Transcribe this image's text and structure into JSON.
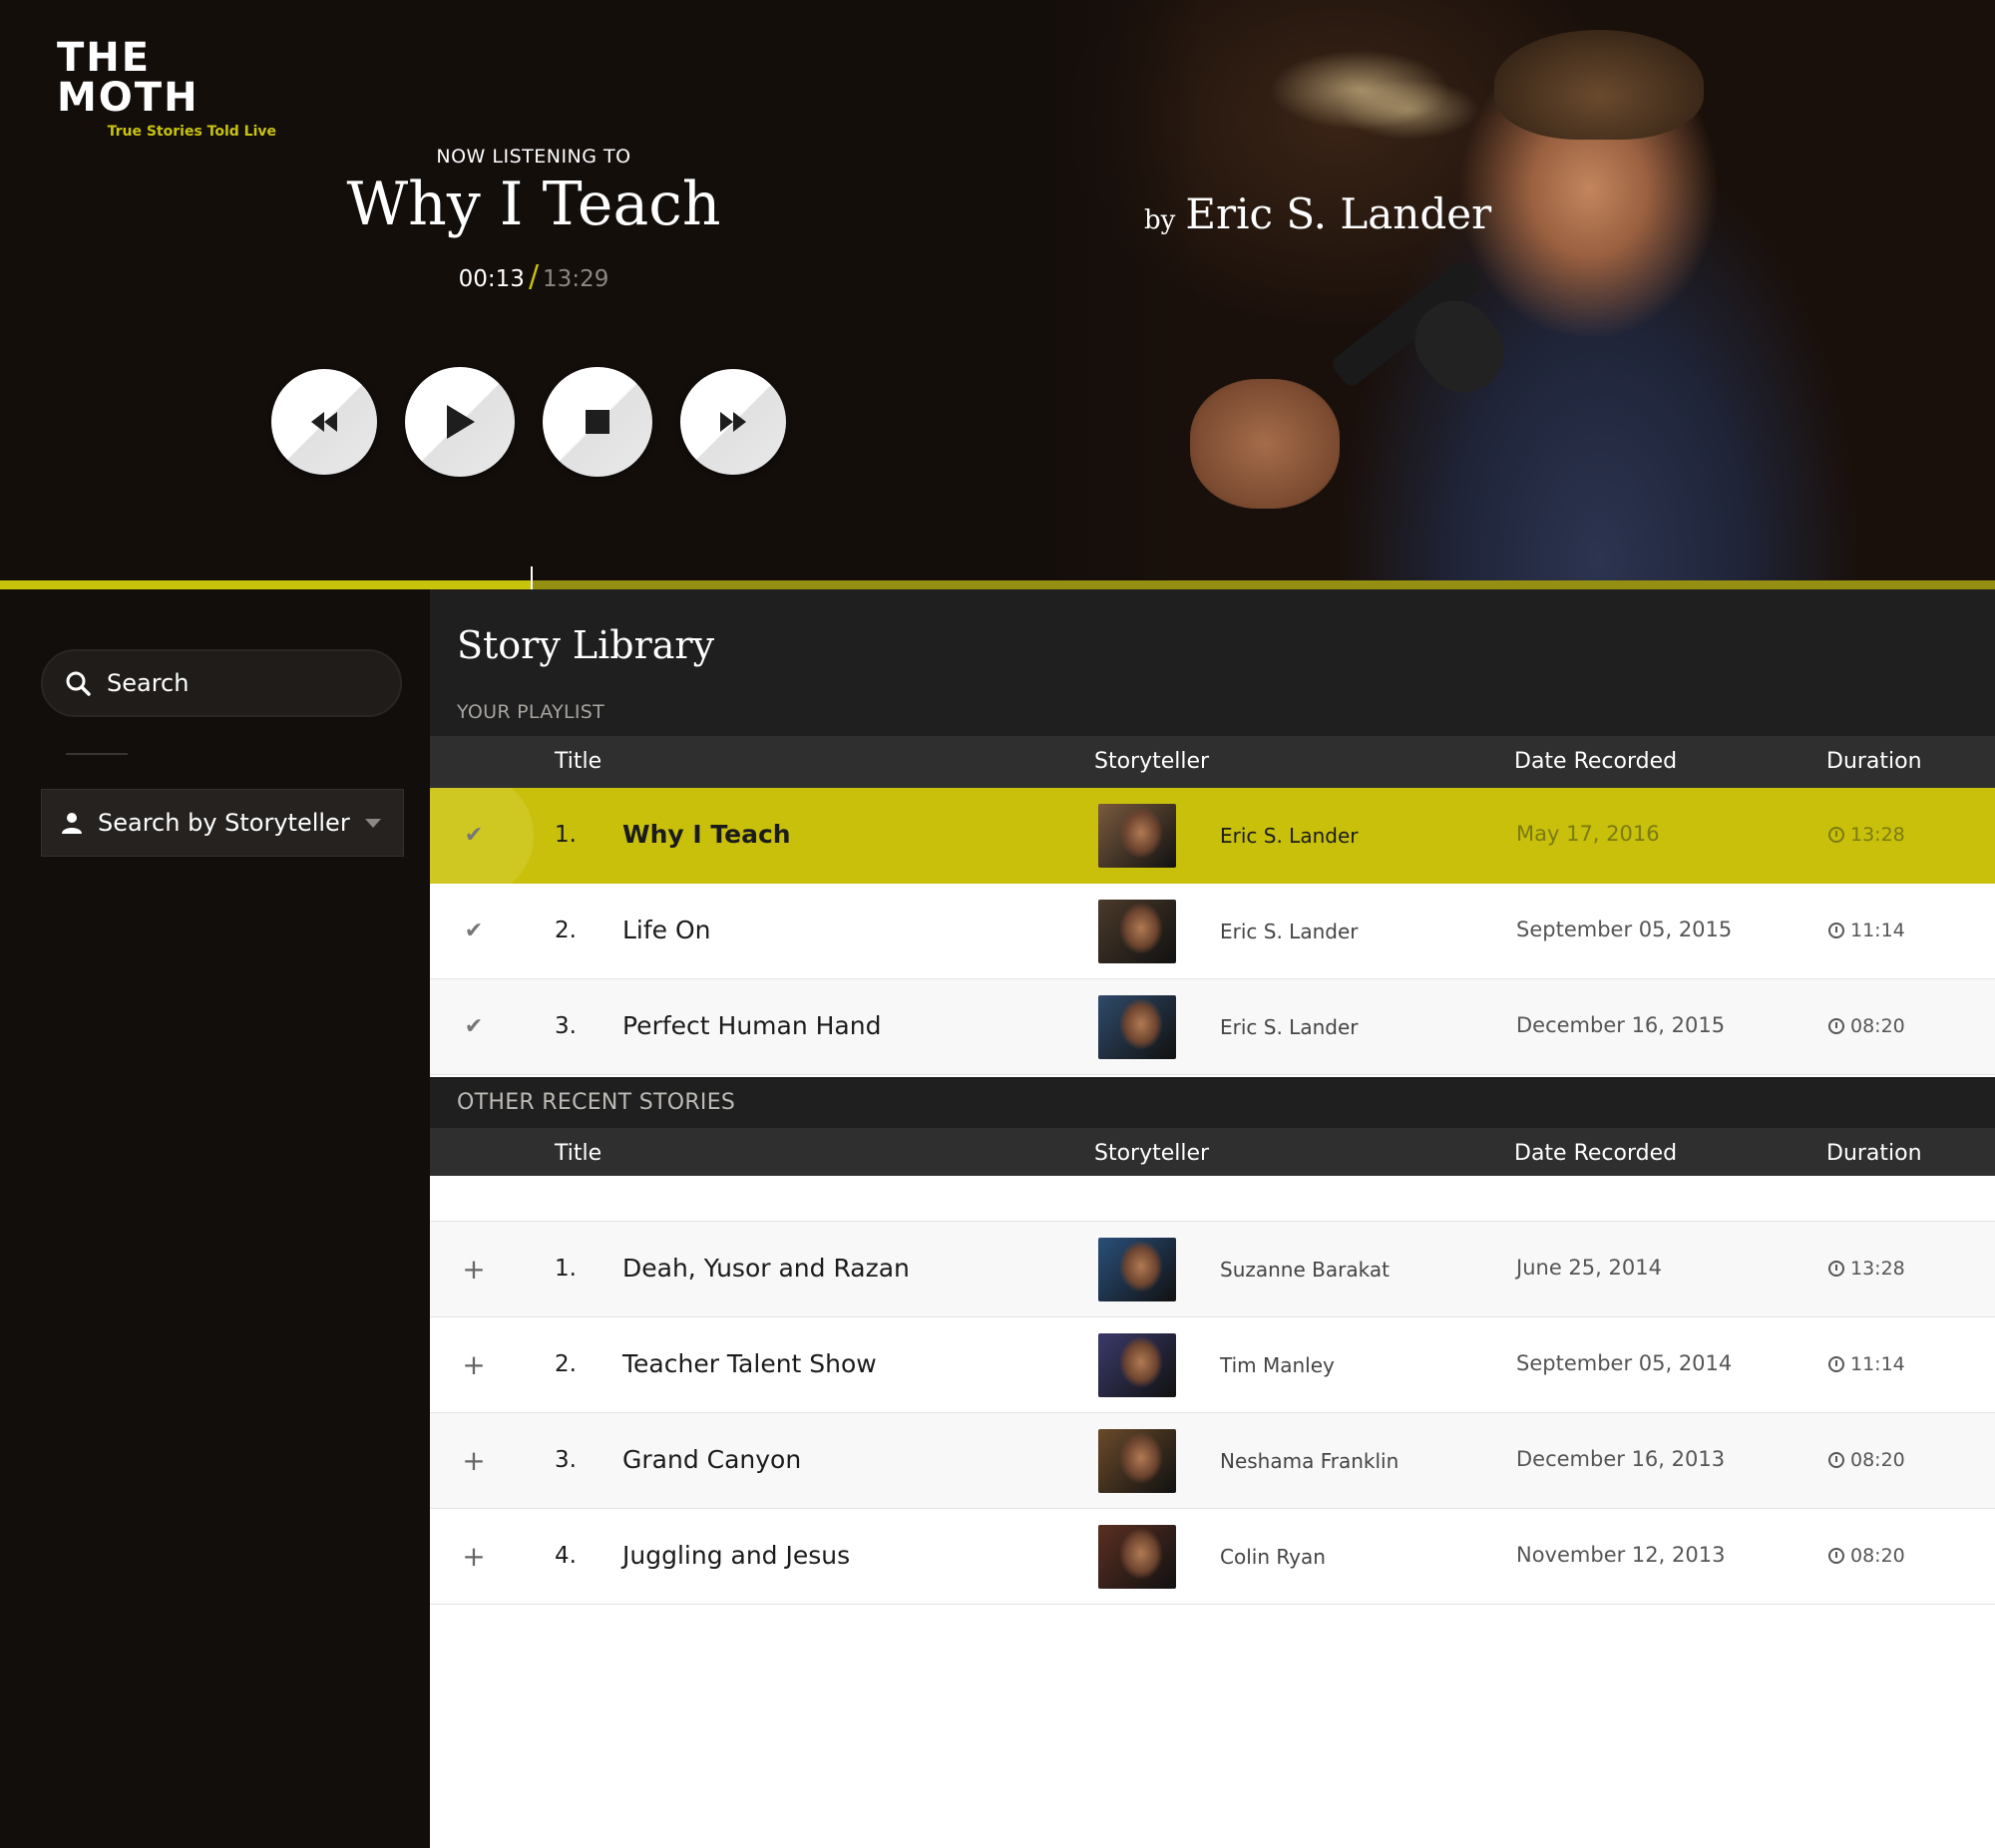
{
  "app": {
    "logo_main": "THE MOTH",
    "logo_sub": "True Stories Told Live",
    "accent_color": "#c8c40c"
  },
  "player": {
    "now_label": "NOW LISTENING TO",
    "title": "Why I Teach",
    "current_time": "00:13",
    "separator": "/",
    "total_time": "13:29",
    "by_label": "by",
    "storyteller": "Eric S. Lander",
    "progress": 0.266,
    "controls": {
      "rewind": "rewind-icon",
      "play": "play-icon",
      "stop": "stop-icon",
      "forward": "fast-forward-icon"
    }
  },
  "sidebar": {
    "search_placeholder": "Search",
    "storyteller_filter": "Search by Storyteller"
  },
  "library": {
    "title": "Story Library",
    "playlist_label": "YOUR PLAYLIST",
    "other_label": "OTHER RECENT STORIES",
    "columns": {
      "title": "Title",
      "storyteller": "Storyteller",
      "date": "Date Recorded",
      "duration": "Duration"
    },
    "playlist": [
      {
        "num": "1.",
        "title": "Why I Teach",
        "storyteller": "Eric S. Lander",
        "date": "May 17, 2016",
        "duration": "13:28",
        "mark": "✔",
        "thumb": "#7a5a3e"
      },
      {
        "num": "2.",
        "title": "Life On",
        "storyteller": "Eric S. Lander",
        "date": "September 05, 2015",
        "duration": "11:14",
        "mark": "✔",
        "thumb": "#4a3a2a"
      },
      {
        "num": "3.",
        "title": "Perfect Human Hand",
        "storyteller": "Eric S. Lander",
        "date": "December 16, 2015",
        "duration": "08:20",
        "mark": "✔",
        "thumb": "#2f4a6a"
      }
    ],
    "other": [
      {
        "num": "1.",
        "title": "Deah, Yusor and Razan",
        "storyteller": "Suzanne Barakat",
        "date": "June 25, 2014",
        "duration": "13:28",
        "mark": "+",
        "thumb": "#2a4f7a"
      },
      {
        "num": "2.",
        "title": "Teacher Talent Show",
        "storyteller": "Tim Manley",
        "date": "September 05, 2014",
        "duration": "11:14",
        "mark": "+",
        "thumb": "#3a3a6a"
      },
      {
        "num": "3.",
        "title": "Grand Canyon",
        "storyteller": "Neshama Franklin",
        "date": "December 16, 2013",
        "duration": "08:20",
        "mark": "+",
        "thumb": "#6a4a2a"
      },
      {
        "num": "4.",
        "title": "Juggling and Jesus",
        "storyteller": "Colin Ryan",
        "date": "November 12, 2013",
        "duration": "08:20",
        "mark": "+",
        "thumb": "#5a2f22"
      }
    ]
  }
}
